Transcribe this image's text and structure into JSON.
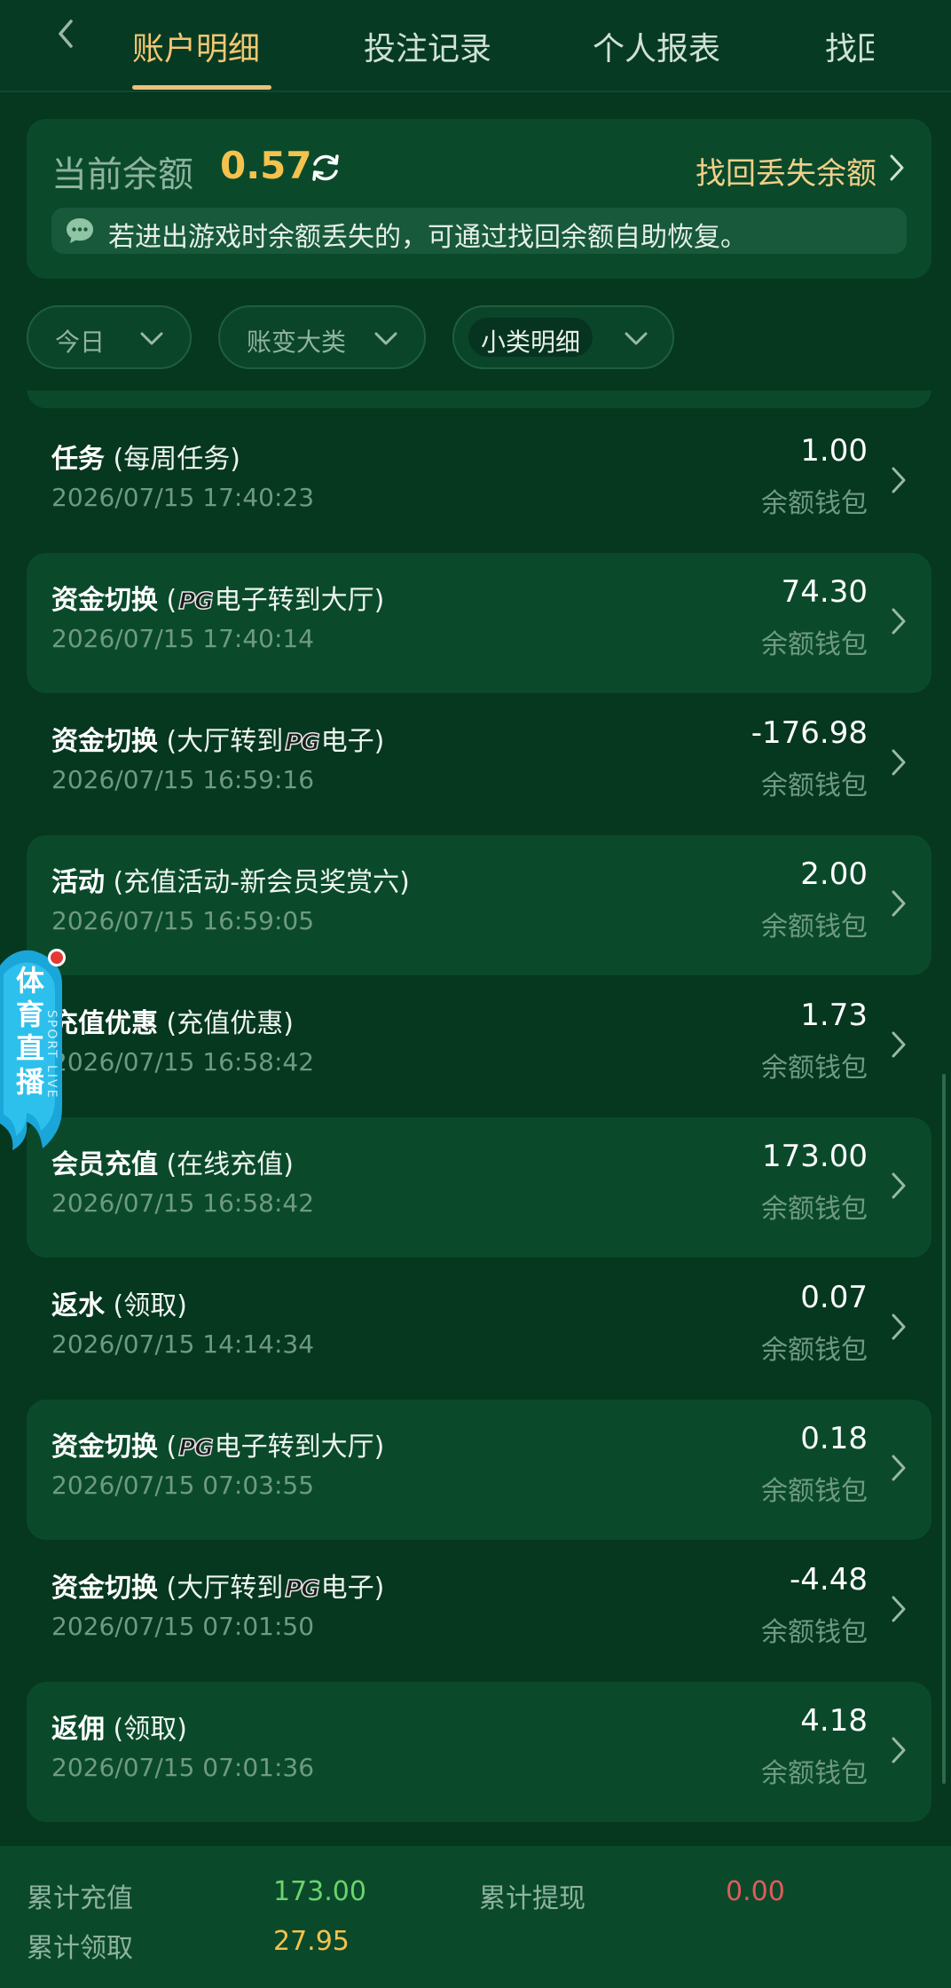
{
  "header": {
    "tabs": [
      {
        "label": "账户明细",
        "active": true
      },
      {
        "label": "投注记录",
        "active": false
      },
      {
        "label": "个人报表",
        "active": false
      },
      {
        "label": "找回",
        "active": false
      }
    ],
    "accent_color": "#f3c772"
  },
  "balance": {
    "label": "当前余额",
    "value": "0.57",
    "recover_link": "找回丢失余额",
    "notice": "若进出游戏时余额丢失的，可通过找回余额自助恢复。"
  },
  "filters": [
    {
      "label": "今日"
    },
    {
      "label": "账变大类"
    },
    {
      "label": "小类明细"
    }
  ],
  "records": [
    {
      "type": "任务",
      "pre": " (每周任务)",
      "pg": "",
      "post": "",
      "time": "2026/07/15 17:40:23",
      "amount": "1.00",
      "wallet": "余额钱包"
    },
    {
      "type": "资金切换",
      "pre": " (",
      "pg": "PG",
      "post": "电子转到大厅)",
      "time": "2026/07/15 17:40:14",
      "amount": "74.30",
      "wallet": "余额钱包"
    },
    {
      "type": "资金切换",
      "pre": " (大厅转到",
      "pg": "PG",
      "post": "电子)",
      "time": "2026/07/15 16:59:16",
      "amount": "-176.98",
      "wallet": "余额钱包"
    },
    {
      "type": "活动",
      "pre": " (充值活动-新会员奖赏六)",
      "pg": "",
      "post": "",
      "time": "2026/07/15 16:59:05",
      "amount": "2.00",
      "wallet": "余额钱包"
    },
    {
      "type": "充值优惠",
      "pre": " (充值优惠)",
      "pg": "",
      "post": "",
      "time": "2026/07/15 16:58:42",
      "amount": "1.73",
      "wallet": "余额钱包"
    },
    {
      "type": "会员充值",
      "pre": " (在线充值)",
      "pg": "",
      "post": "",
      "time": "2026/07/15 16:58:42",
      "amount": "173.00",
      "wallet": "余额钱包"
    },
    {
      "type": "返水",
      "pre": " (领取)",
      "pg": "",
      "post": "",
      "time": "2026/07/15 14:14:34",
      "amount": "0.07",
      "wallet": "余额钱包"
    },
    {
      "type": "资金切换",
      "pre": " (",
      "pg": "PG",
      "post": "电子转到大厅)",
      "time": "2026/07/15 07:03:55",
      "amount": "0.18",
      "wallet": "余额钱包"
    },
    {
      "type": "资金切换",
      "pre": " (大厅转到",
      "pg": "PG",
      "post": "电子)",
      "time": "2026/07/15 07:01:50",
      "amount": "-4.48",
      "wallet": "余额钱包"
    },
    {
      "type": "返佣",
      "pre": " (领取)",
      "pg": "",
      "post": "",
      "time": "2026/07/15 07:01:36",
      "amount": "4.18",
      "wallet": "余额钱包"
    }
  ],
  "sport_live": {
    "label": "体育直播",
    "sub": "SPORT LIVE"
  },
  "footer": {
    "total_deposit_label": "累计充值",
    "total_deposit_value": "173.00",
    "total_withdraw_label": "累计提现",
    "total_withdraw_value": "0.00",
    "total_claim_label": "累计领取",
    "total_claim_value": "27.95",
    "colors": {
      "deposit": "#6dd36b",
      "withdraw": "#e35a5a",
      "claim": "#f4c24d"
    }
  }
}
